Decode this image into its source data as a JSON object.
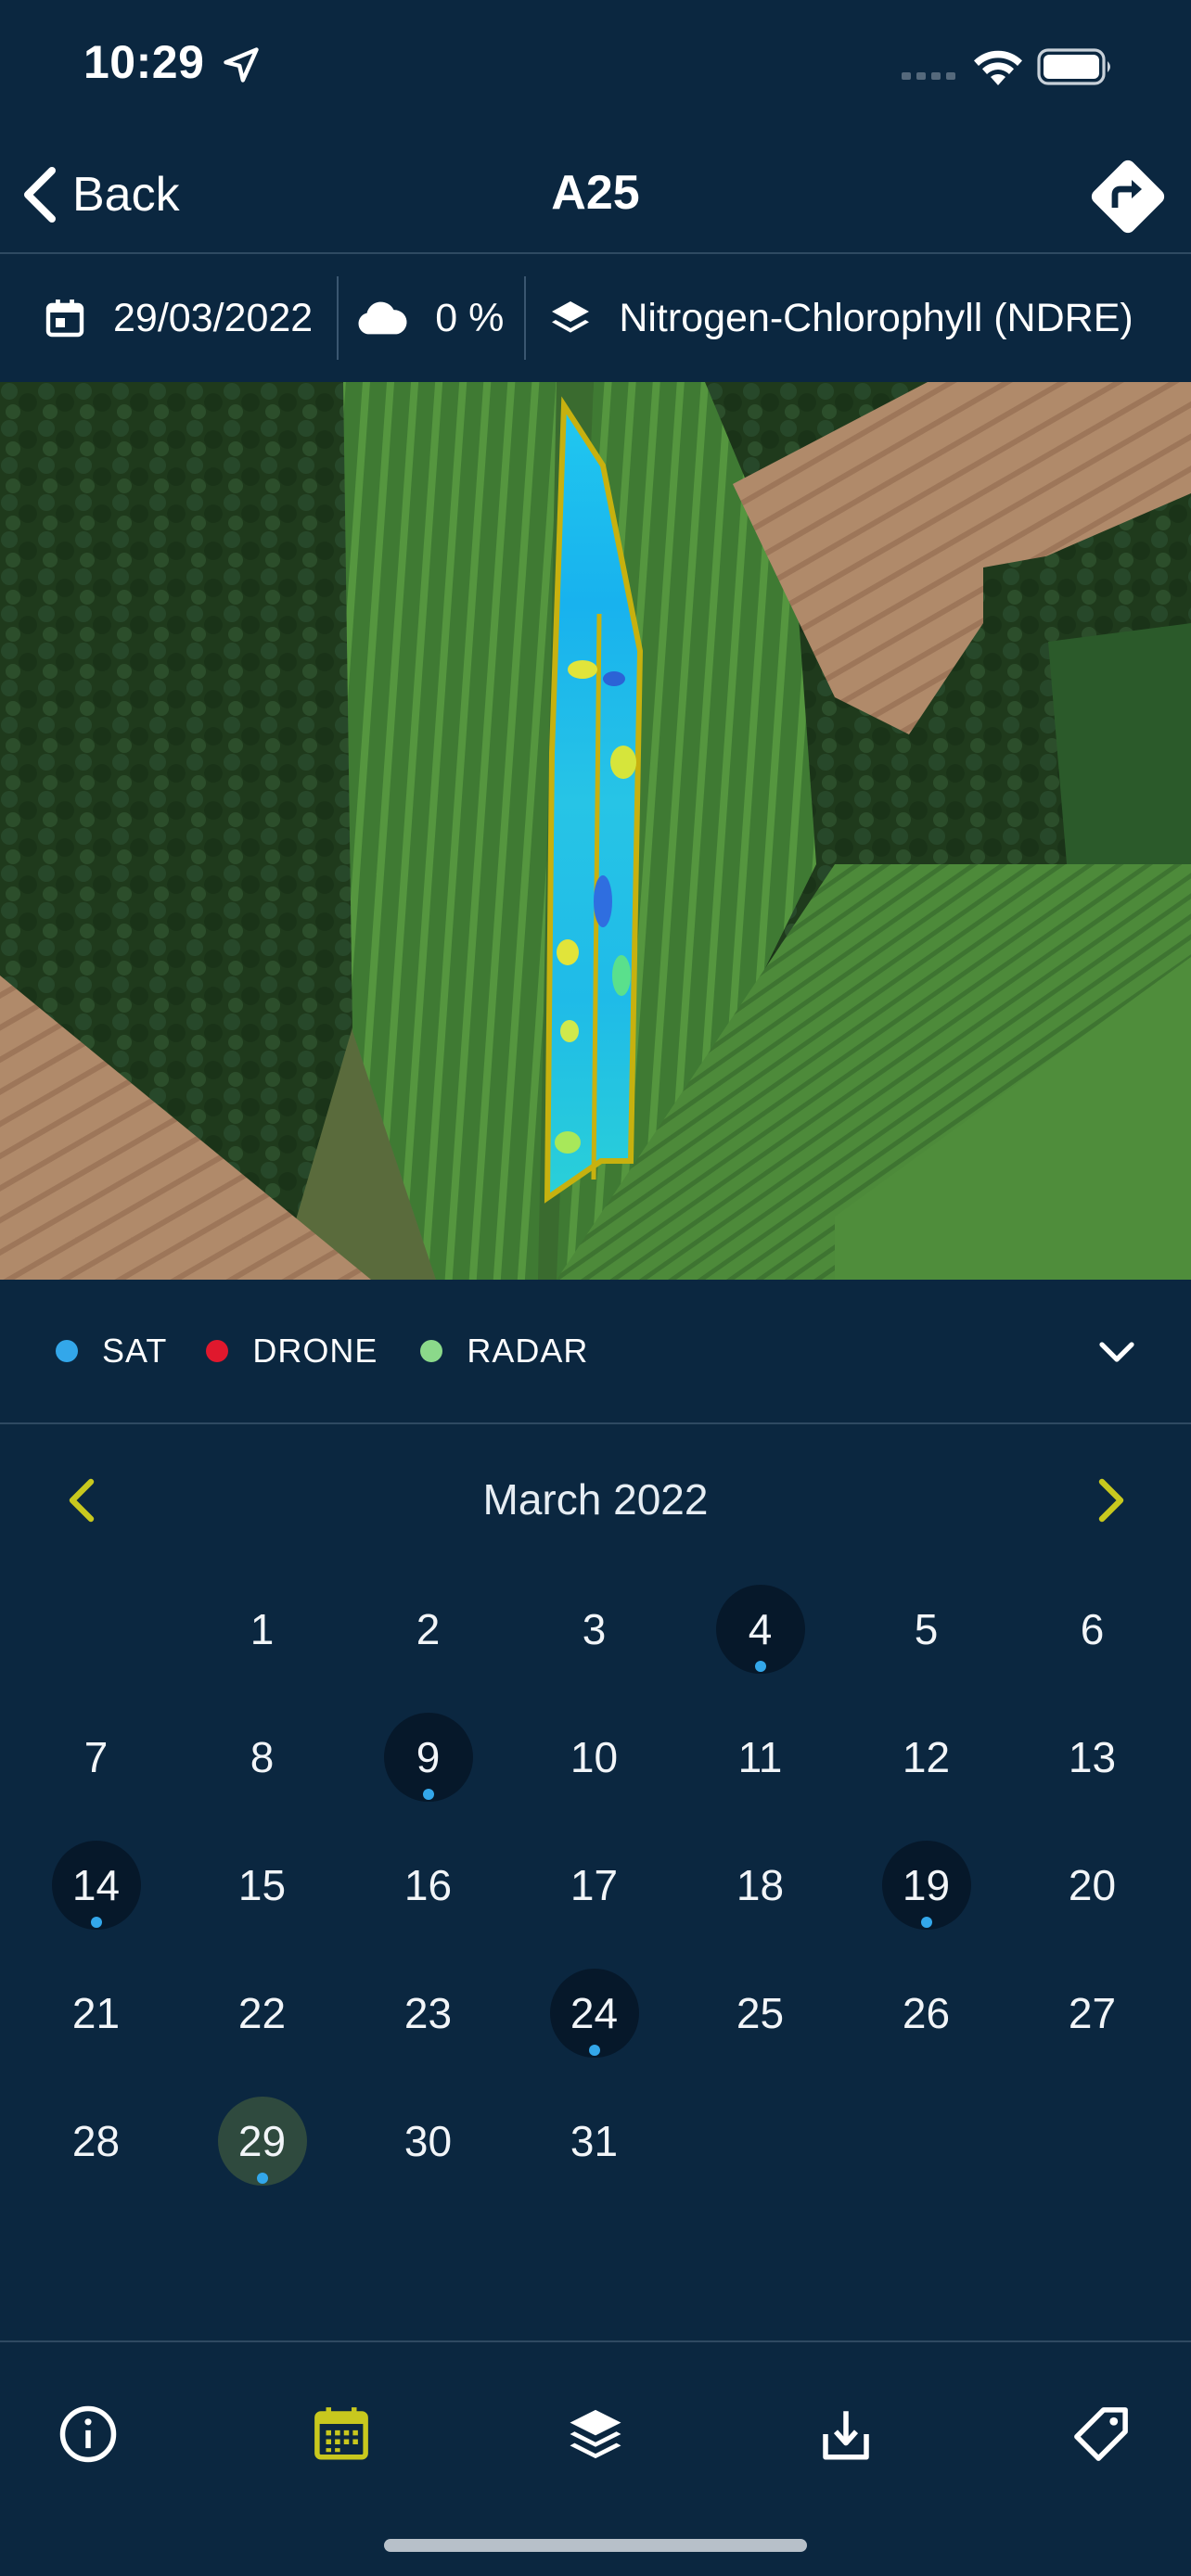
{
  "status_bar": {
    "time": "10:29"
  },
  "nav": {
    "back_label": "Back",
    "title": "A25"
  },
  "info": {
    "date": "29/03/2022",
    "cloud": "0 %",
    "layer": "Nitrogen-Chlorophyll (NDRE)"
  },
  "legend": {
    "items": [
      {
        "label": "SAT",
        "color": "#33a7ea"
      },
      {
        "label": "DRONE",
        "color": "#e0182d"
      },
      {
        "label": "RADAR",
        "color": "#8bd98a"
      }
    ]
  },
  "calendar": {
    "title": "March 2022",
    "accent_color": "#c8c81e",
    "selected_day": "29",
    "days": [
      {
        "n": "",
        "img": false
      },
      {
        "n": "1",
        "img": false
      },
      {
        "n": "2",
        "img": false
      },
      {
        "n": "3",
        "img": false
      },
      {
        "n": "4",
        "img": true
      },
      {
        "n": "5",
        "img": false
      },
      {
        "n": "6",
        "img": false
      },
      {
        "n": "7",
        "img": false
      },
      {
        "n": "8",
        "img": false
      },
      {
        "n": "9",
        "img": true
      },
      {
        "n": "10",
        "img": false
      },
      {
        "n": "11",
        "img": false
      },
      {
        "n": "12",
        "img": false
      },
      {
        "n": "13",
        "img": false
      },
      {
        "n": "14",
        "img": true
      },
      {
        "n": "15",
        "img": false
      },
      {
        "n": "16",
        "img": false
      },
      {
        "n": "17",
        "img": false
      },
      {
        "n": "18",
        "img": false
      },
      {
        "n": "19",
        "img": true
      },
      {
        "n": "20",
        "img": false
      },
      {
        "n": "21",
        "img": false
      },
      {
        "n": "22",
        "img": false
      },
      {
        "n": "23",
        "img": false
      },
      {
        "n": "24",
        "img": true
      },
      {
        "n": "25",
        "img": false
      },
      {
        "n": "26",
        "img": false
      },
      {
        "n": "27",
        "img": false
      },
      {
        "n": "28",
        "img": false
      },
      {
        "n": "29",
        "img": true
      },
      {
        "n": "30",
        "img": false
      },
      {
        "n": "31",
        "img": false
      }
    ]
  },
  "tabs": [
    {
      "name": "tab-info",
      "icon": "info-icon",
      "active": false
    },
    {
      "name": "tab-calendar",
      "icon": "calendar-icon",
      "active": true
    },
    {
      "name": "tab-layers",
      "icon": "layers-icon",
      "active": false
    },
    {
      "name": "tab-download",
      "icon": "download-icon",
      "active": false
    },
    {
      "name": "tab-tag",
      "icon": "tag-icon",
      "active": false
    }
  ]
}
